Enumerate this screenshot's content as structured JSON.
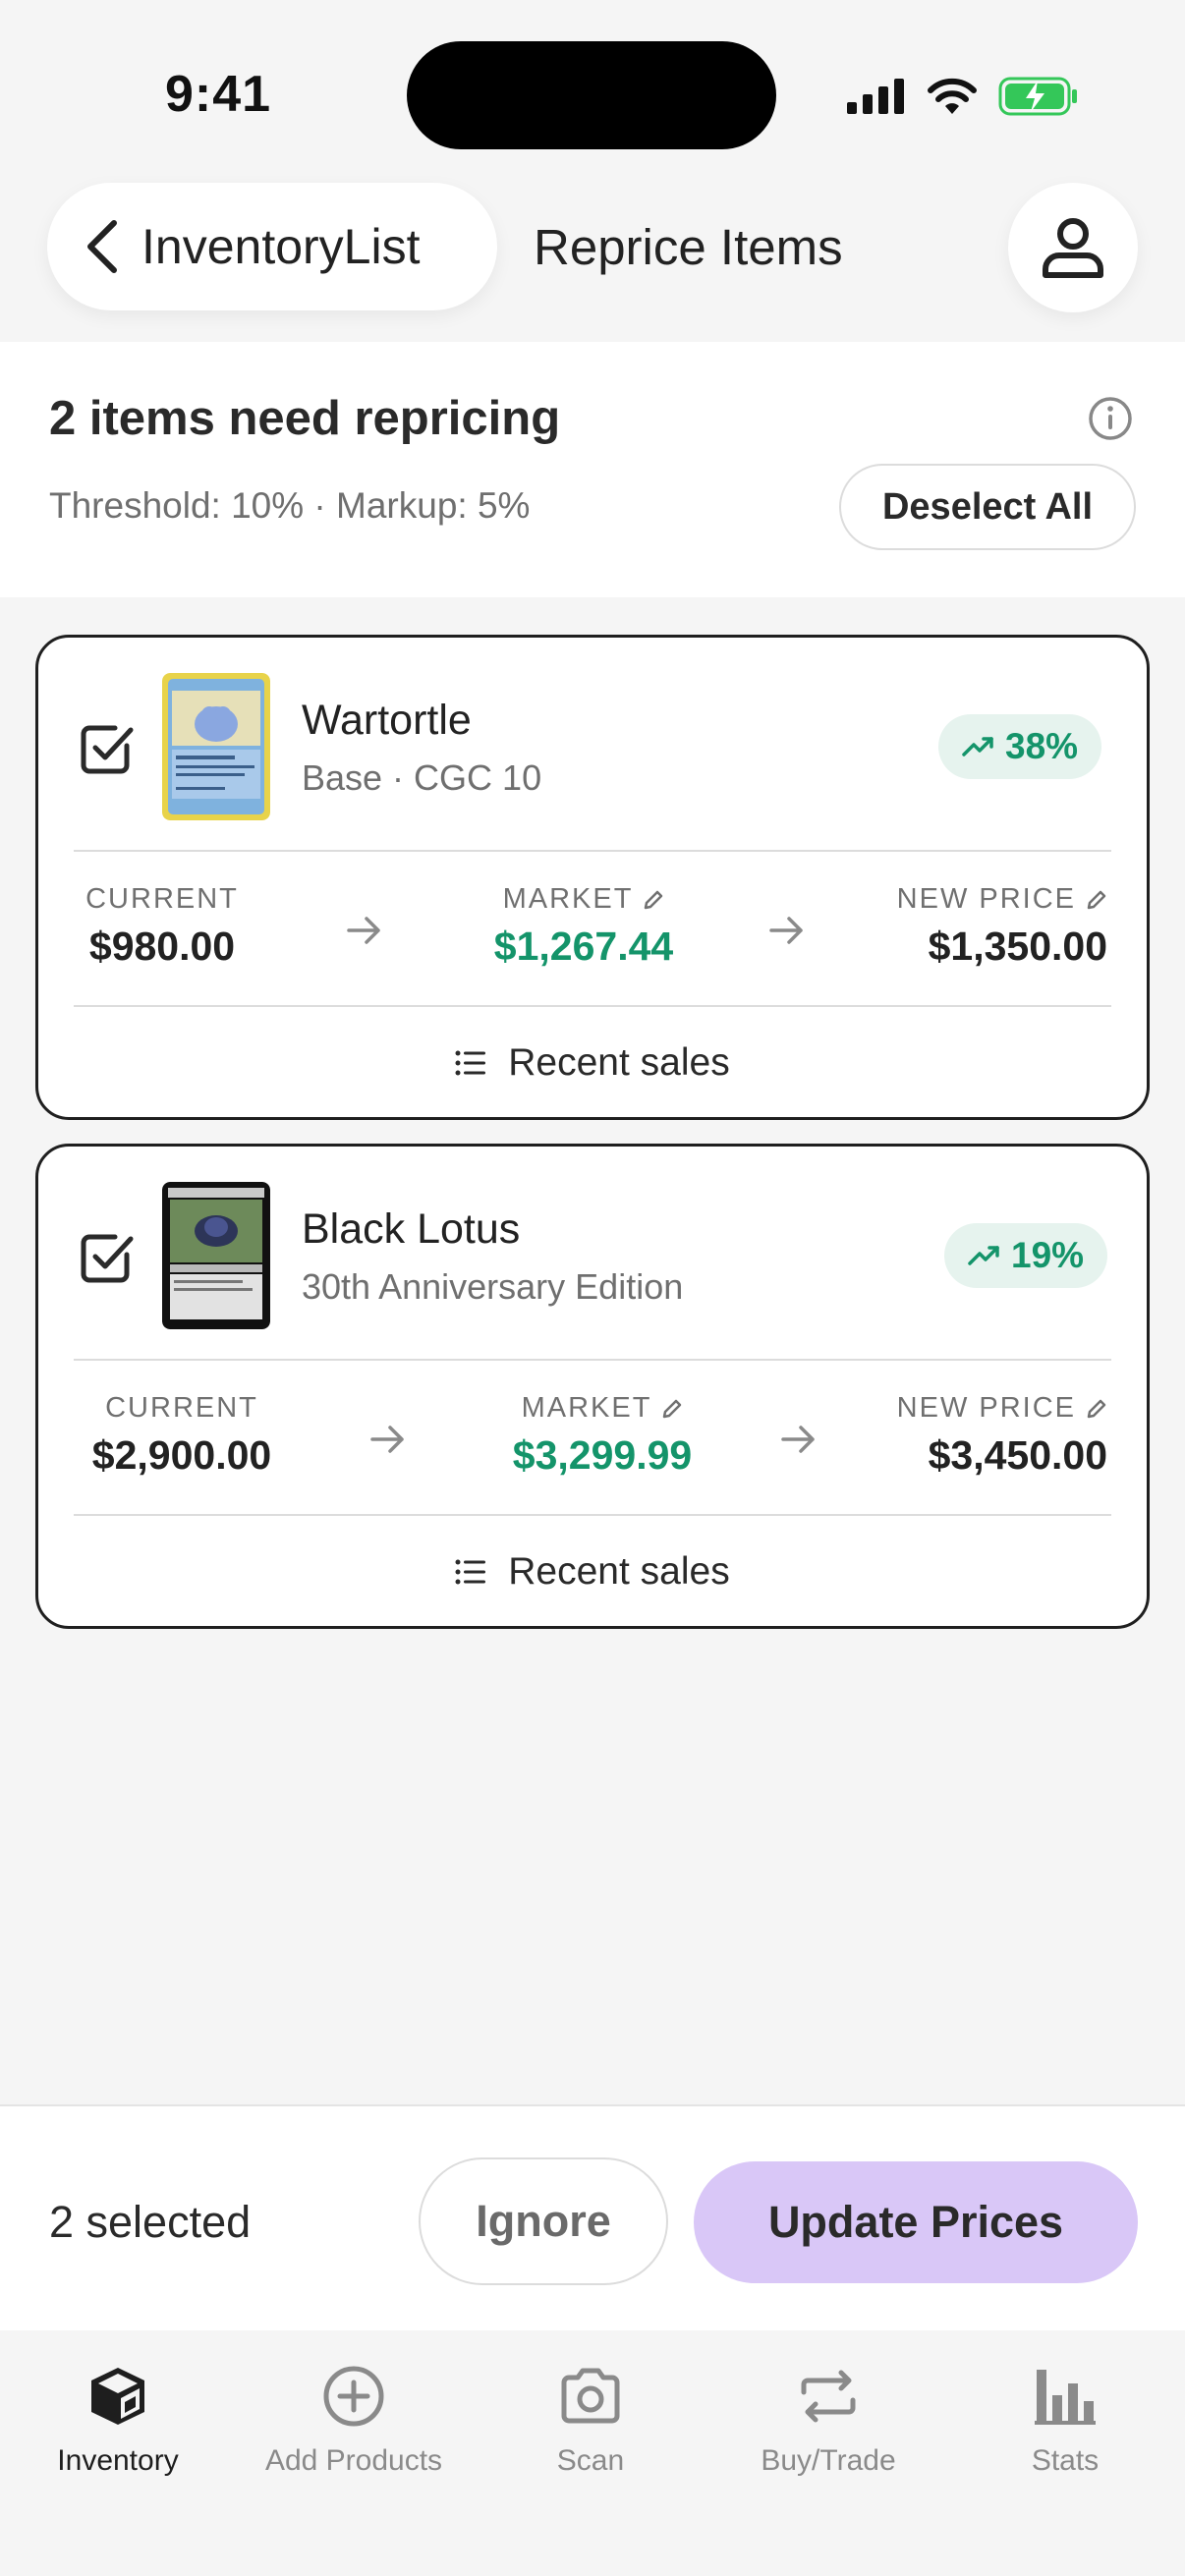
{
  "status_bar": {
    "time": "9:41"
  },
  "header": {
    "back_label": "InventoryList",
    "title": "Reprice Items"
  },
  "summary": {
    "title": "2 items need repricing",
    "subtitle": "Threshold: 10% · Markup: 5%",
    "deselect_label": "Deselect All"
  },
  "items": [
    {
      "name": "Wartortle",
      "subtitle": "Base · CGC 10",
      "change": "38%",
      "current_label": "CURRENT",
      "current": "$980.00",
      "market_label": "MARKET",
      "market": "$1,267.44",
      "new_label": "NEW PRICE",
      "new_price": "$1,350.00",
      "recent_label": "Recent sales"
    },
    {
      "name": "Black Lotus",
      "subtitle": "30th Anniversary Edition",
      "change": "19%",
      "current_label": "CURRENT",
      "current": "$2,900.00",
      "market_label": "MARKET",
      "market": "$3,299.99",
      "new_label": "NEW PRICE",
      "new_price": "$3,450.00",
      "recent_label": "Recent sales"
    }
  ],
  "action_bar": {
    "selected": "2 selected",
    "ignore_label": "Ignore",
    "update_label": "Update Prices"
  },
  "tabs": [
    {
      "label": "Inventory",
      "icon": "cube-icon"
    },
    {
      "label": "Add Products",
      "icon": "plus-circle-icon"
    },
    {
      "label": "Scan",
      "icon": "camera-icon"
    },
    {
      "label": "Buy/Trade",
      "icon": "swap-icon"
    },
    {
      "label": "Stats",
      "icon": "bar-chart-icon"
    }
  ],
  "colors": {
    "accent_green": "#14946a",
    "badge_bg": "#e6f3ee",
    "primary_button": "#d9c7f7",
    "battery_green": "#34c759"
  }
}
